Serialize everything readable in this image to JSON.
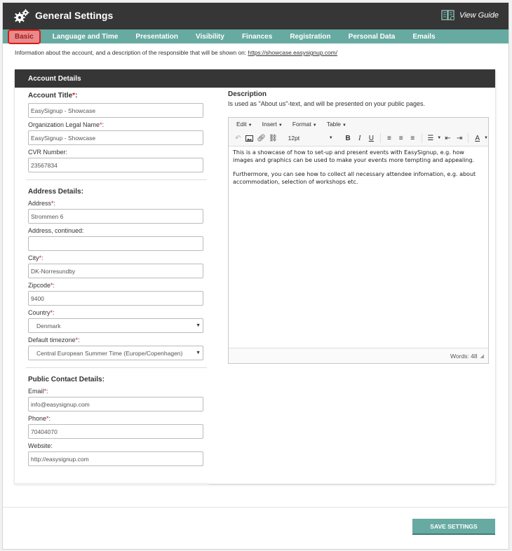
{
  "header": {
    "title": "General Settings",
    "guide_label": "View Guide"
  },
  "tabs": [
    {
      "label": "Basic",
      "active": true
    },
    {
      "label": "Language and Time"
    },
    {
      "label": "Presentation"
    },
    {
      "label": "Visibility"
    },
    {
      "label": "Finances"
    },
    {
      "label": "Registration"
    },
    {
      "label": "Personal Data"
    },
    {
      "label": "Emails"
    }
  ],
  "info": {
    "text": "Information about the account, and a description of the responsible that will be shown on: ",
    "link": "https://showcase.easysignup.com/"
  },
  "panel": {
    "title": "Account Details"
  },
  "account": {
    "section_title": "Account Title",
    "title_value": "EasySignup - Showcase",
    "legal_label": "Organization Legal Name",
    "legal_value": "EasySignup - Showcase",
    "cvr_label": "CVR Number:",
    "cvr_value": "23567834"
  },
  "address": {
    "section_title": "Address Details:",
    "address_label": "Address",
    "address_value": "Strommen 6",
    "address2_label": "Address, continued:",
    "address2_value": "",
    "city_label": "City",
    "city_value": "DK-Norresundby",
    "zip_label": "Zipcode",
    "zip_value": "9400",
    "country_label": "Country",
    "country_value": "Denmark",
    "tz_label": "Default timezone",
    "tz_value": "Central European Summer Time (Europe/Copenhagen)"
  },
  "contact": {
    "section_title": "Public Contact Details:",
    "email_label": "Email",
    "email_value": "info@easysignup.com",
    "phone_label": "Phone",
    "phone_value": "70404070",
    "website_label": "Website:",
    "website_value": "http://easysignup.com"
  },
  "description": {
    "title": "Description",
    "subtitle": "Is used as \"About us\"-text, and will be presented on your public pages.",
    "menus": [
      "Edit",
      "Insert",
      "Format",
      "Table"
    ],
    "font_size": "12pt",
    "paragraphs": [
      "This is a showcase of how to set-up and present events with EasySignup, e.g. how images and graphics can be used to make your events more tempting and appealing.",
      "Furthermore, you can see how to collect all necessary attendee infomation, e.g. about accommodation, selection of workshops etc."
    ],
    "word_count": "Words: 48"
  },
  "footer": {
    "save_label": "SAVE SETTINGS"
  },
  "colors": {
    "teal": "#67aaa1",
    "dark": "#363636",
    "required": "#d41c1c"
  }
}
